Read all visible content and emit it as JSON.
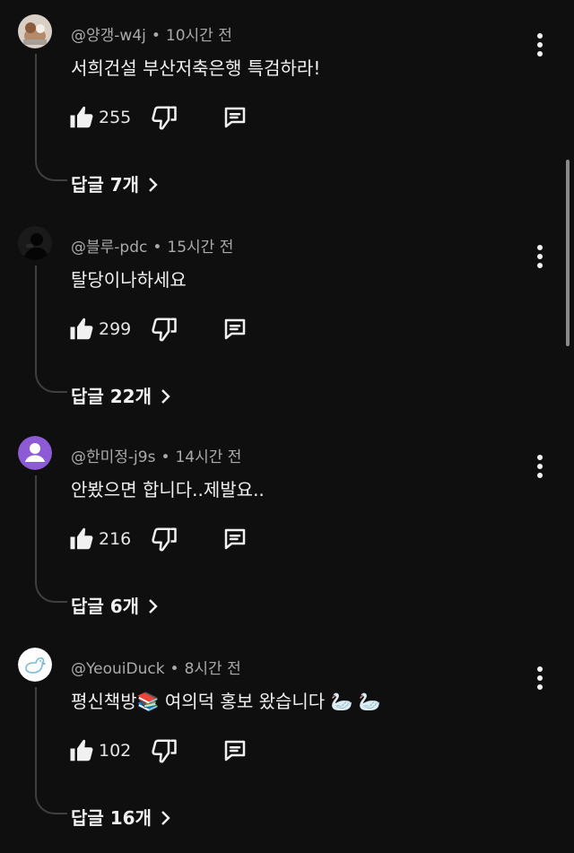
{
  "comments": [
    {
      "author": "@양갱-w4j",
      "time": "10시간 전",
      "text": "서희건설 부산저축은행 특검하라!",
      "likes": "255",
      "replies": "답글 7개",
      "avatar_icon": "photo-avatar"
    },
    {
      "author": "@블루-pdc",
      "time": "15시간 전",
      "text": "탈당이나하세요",
      "likes": "299",
      "replies": "답글 22개",
      "avatar_icon": "silhouette-avatar"
    },
    {
      "author": "@한미정-j9s",
      "time": "14시간 전",
      "text": "안봤으면 합니다..제발요..",
      "likes": "216",
      "replies": "답글 6개",
      "avatar_icon": "default-person-avatar",
      "avatar_color": "#8e5bd6"
    },
    {
      "author": "@YeouiDuck",
      "time": "8시간 전",
      "text": "평신책방📚 여의덕 홍보 왔습니다 🦢 🦢",
      "likes": "102",
      "replies": "답글 16개",
      "avatar_icon": "duck-logo-avatar"
    }
  ],
  "separator": "•",
  "colors": {
    "background": "#0f0f0f",
    "text": "#f1f1f1",
    "meta": "#aaaaaa",
    "thread_line": "#3f3f3f"
  }
}
